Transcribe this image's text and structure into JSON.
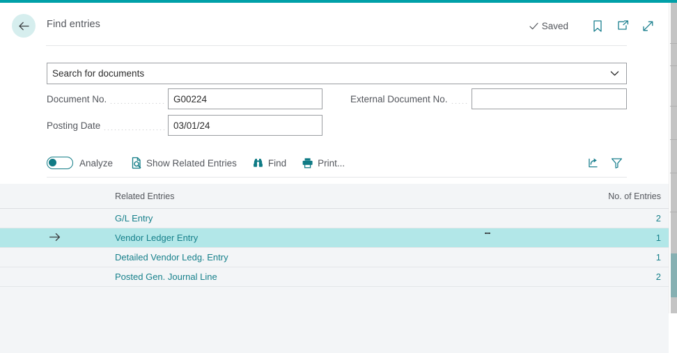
{
  "theme": {
    "accent": "#00a0a8",
    "link": "#16808b",
    "selection": "#b2e7e8",
    "back_circle": "#d6eeee",
    "grid_bg": "#f3f5f7",
    "label": "#53565c"
  },
  "header": {
    "back_label": "Back",
    "title": "Find entries",
    "saved_label": "Saved",
    "bookmark_label": "Bookmark",
    "open_new_window_label": "Open in new window",
    "expand_label": "Expand"
  },
  "search": {
    "value": "Search for documents",
    "placeholder": "Search for documents",
    "dropdown_label": "Show options"
  },
  "form": {
    "fields": [
      {
        "label": "Document No.",
        "value": "G00224",
        "placeholder": ""
      },
      {
        "label": "Posting Date",
        "value": "03/01/24",
        "placeholder": ""
      },
      {
        "label": "External Document No.",
        "value": "",
        "placeholder": ""
      }
    ]
  },
  "toolbar": {
    "analyze_label": "Analyze",
    "analyze_toggle_on": false,
    "show_related_entries_label": "Show Related Entries",
    "find_label": "Find",
    "print_label": "Print...",
    "share_label": "Share",
    "filter_label": "Filter"
  },
  "grid": {
    "columns": [
      "Related Entries",
      "No. of Entries"
    ],
    "rows": [
      {
        "name": "G/L Entry",
        "count": "2",
        "selected": false
      },
      {
        "name": "Vendor Ledger Entry",
        "count": "1",
        "selected": true
      },
      {
        "name": "Detailed Vendor Ledg. Entry",
        "count": "1",
        "selected": false
      },
      {
        "name": "Posted Gen. Journal Line",
        "count": "2",
        "selected": false
      }
    ]
  }
}
